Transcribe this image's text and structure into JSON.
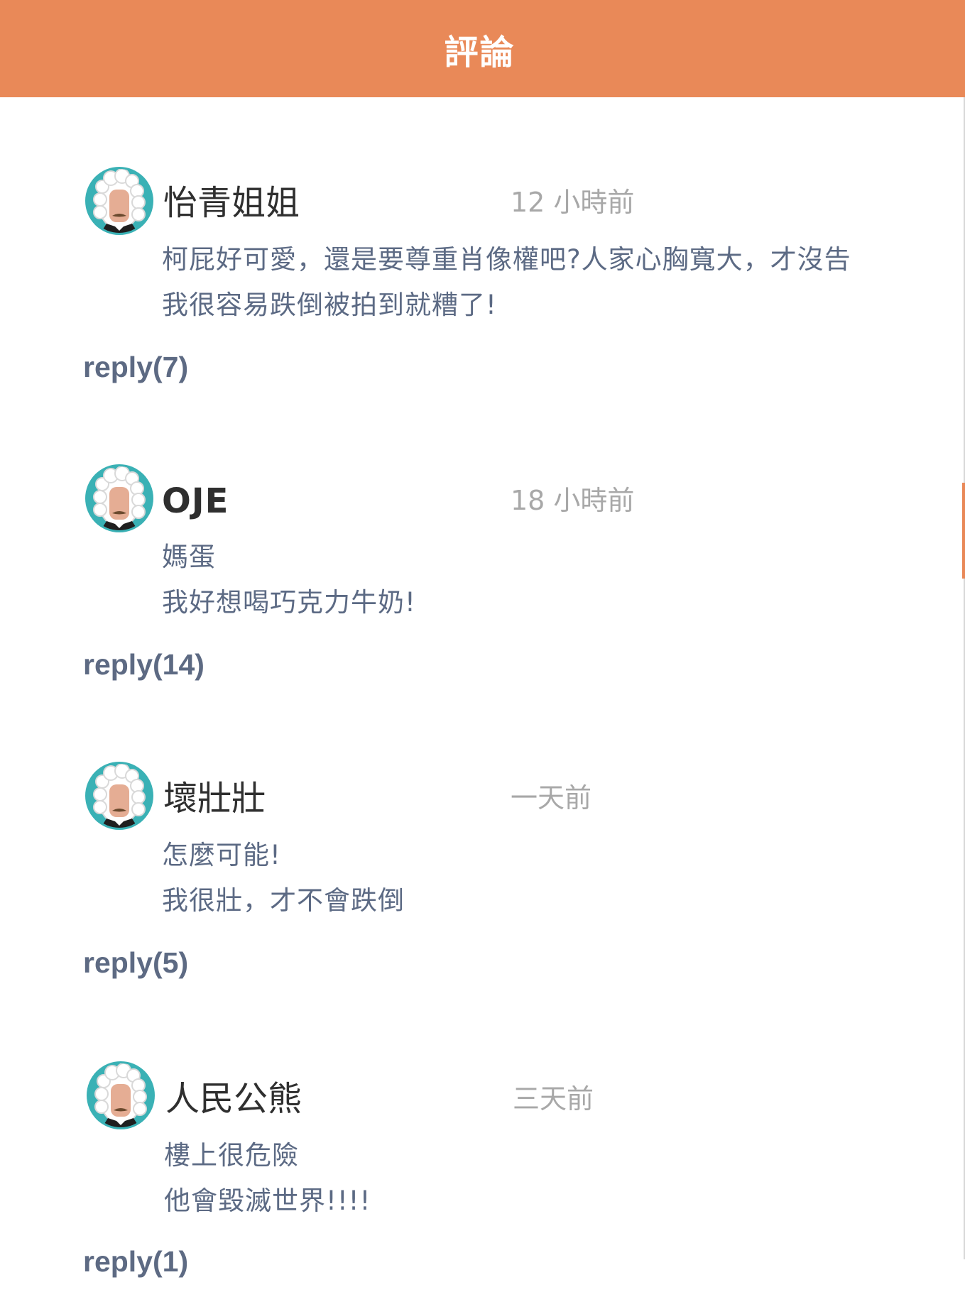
{
  "header": {
    "title": "評論"
  },
  "colors": {
    "header_bg": "#e98958",
    "avatar_ring": "#3ab1b5",
    "body_text": "#5c6a84",
    "time_text": "#a8a8a8",
    "reply_text": "#5d6a83"
  },
  "comments": [
    {
      "author": "怡青姐姐",
      "avatar_icon": "judge-wig-avatar-icon",
      "time": "12 小時前",
      "lines": [
        "柯屁好可愛，還是要尊重肖像權吧?人家心胸寬大，才沒告",
        "我很容易跌倒被拍到就糟了!"
      ],
      "reply": "reply(7)"
    },
    {
      "author": "OJE",
      "avatar_icon": "judge-wig-avatar-icon",
      "time": "18 小時前",
      "lines": [
        "媽蛋",
        "我好想喝巧克力牛奶!"
      ],
      "reply": "reply(14)"
    },
    {
      "author": "壞壯壯",
      "avatar_icon": "judge-wig-avatar-icon",
      "time": "一天前",
      "lines": [
        "怎麼可能!",
        "我很壯，才不會跌倒"
      ],
      "reply": "reply(5)"
    },
    {
      "author": "人民公熊",
      "avatar_icon": "judge-wig-avatar-icon",
      "time": "三天前",
      "lines": [
        "樓上很危險",
        "他會毀滅世界!!!!"
      ],
      "reply": "reply(1)"
    }
  ]
}
